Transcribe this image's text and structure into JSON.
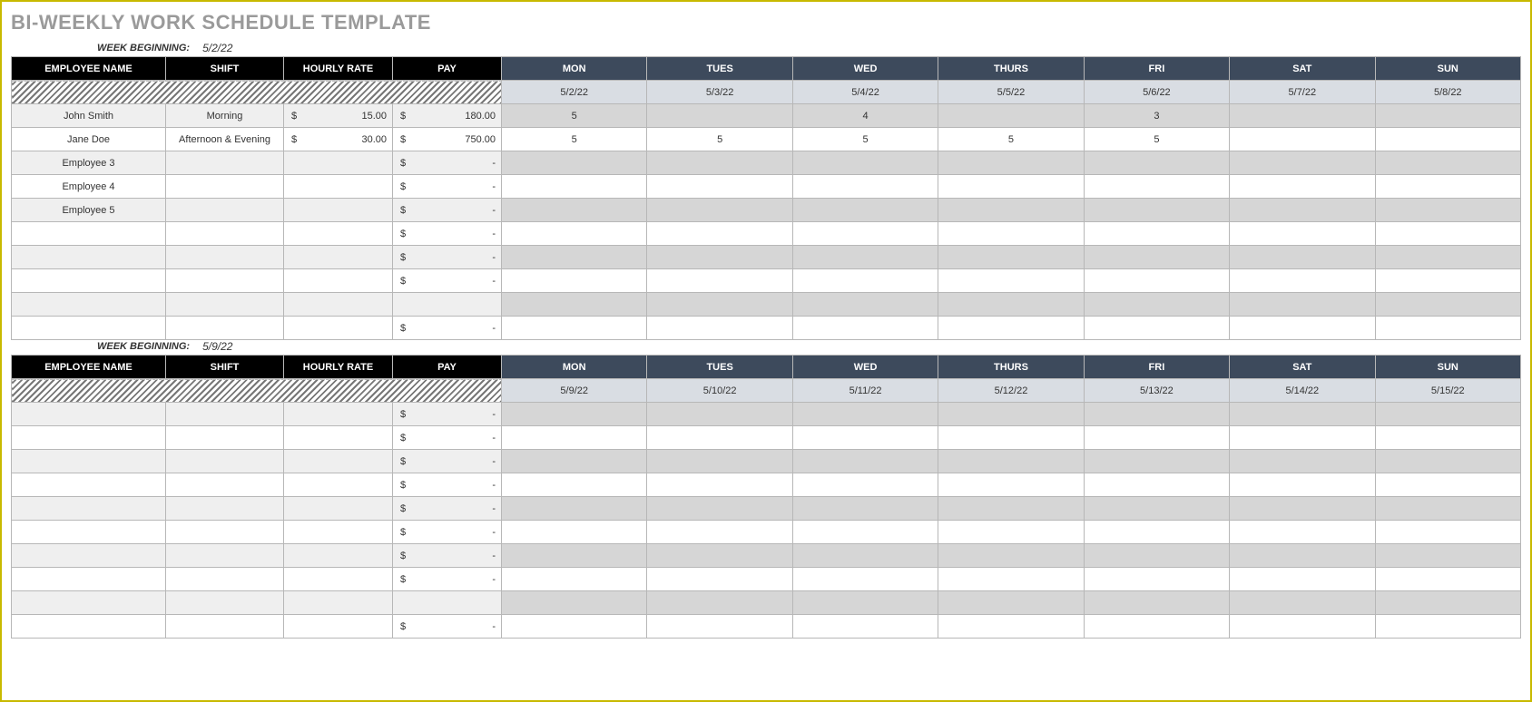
{
  "title": "BI-WEEKLY WORK SCHEDULE TEMPLATE",
  "currency_symbol": "$",
  "headers_left": [
    "EMPLOYEE NAME",
    "SHIFT",
    "HOURLY RATE",
    "PAY"
  ],
  "headers_days": [
    "MON",
    "TUES",
    "WED",
    "THURS",
    "FRI",
    "SAT",
    "SUN"
  ],
  "week_beginning_label": "WEEK BEGINNING:",
  "weeks": [
    {
      "week_beginning": "5/2/22",
      "dates": [
        "5/2/22",
        "5/3/22",
        "5/4/22",
        "5/5/22",
        "5/6/22",
        "5/7/22",
        "5/8/22"
      ],
      "rows": [
        {
          "name": "John Smith",
          "shift": "Morning",
          "rate": "15.00",
          "pay": "180.00",
          "days": [
            "5",
            "",
            "4",
            "",
            "3",
            "",
            ""
          ]
        },
        {
          "name": "Jane Doe",
          "shift": "Afternoon & Evening",
          "rate": "30.00",
          "pay": "750.00",
          "days": [
            "5",
            "5",
            "5",
            "5",
            "5",
            "",
            ""
          ]
        },
        {
          "name": "Employee 3",
          "shift": "",
          "rate": "",
          "pay": "-",
          "days": [
            "",
            "",
            "",
            "",
            "",
            "",
            ""
          ]
        },
        {
          "name": "Employee 4",
          "shift": "",
          "rate": "",
          "pay": "-",
          "days": [
            "",
            "",
            "",
            "",
            "",
            "",
            ""
          ]
        },
        {
          "name": "Employee 5",
          "shift": "",
          "rate": "",
          "pay": "-",
          "days": [
            "",
            "",
            "",
            "",
            "",
            "",
            ""
          ]
        },
        {
          "name": "",
          "shift": "",
          "rate": "",
          "pay": "-",
          "days": [
            "",
            "",
            "",
            "",
            "",
            "",
            ""
          ]
        },
        {
          "name": "",
          "shift": "",
          "rate": "",
          "pay": "-",
          "days": [
            "",
            "",
            "",
            "",
            "",
            "",
            ""
          ]
        },
        {
          "name": "",
          "shift": "",
          "rate": "",
          "pay": "-",
          "days": [
            "",
            "",
            "",
            "",
            "",
            "",
            ""
          ]
        },
        {
          "name": "",
          "shift": "",
          "rate": "",
          "pay": "",
          "days": [
            "",
            "",
            "",
            "",
            "",
            "",
            ""
          ]
        },
        {
          "name": "",
          "shift": "",
          "rate": "",
          "pay": "-",
          "days": [
            "",
            "",
            "",
            "",
            "",
            "",
            ""
          ]
        }
      ]
    },
    {
      "week_beginning": "5/9/22",
      "dates": [
        "5/9/22",
        "5/10/22",
        "5/11/22",
        "5/12/22",
        "5/13/22",
        "5/14/22",
        "5/15/22"
      ],
      "rows": [
        {
          "name": "",
          "shift": "",
          "rate": "",
          "pay": "-",
          "days": [
            "",
            "",
            "",
            "",
            "",
            "",
            ""
          ]
        },
        {
          "name": "",
          "shift": "",
          "rate": "",
          "pay": "-",
          "days": [
            "",
            "",
            "",
            "",
            "",
            "",
            ""
          ]
        },
        {
          "name": "",
          "shift": "",
          "rate": "",
          "pay": "-",
          "days": [
            "",
            "",
            "",
            "",
            "",
            "",
            ""
          ]
        },
        {
          "name": "",
          "shift": "",
          "rate": "",
          "pay": "-",
          "days": [
            "",
            "",
            "",
            "",
            "",
            "",
            ""
          ]
        },
        {
          "name": "",
          "shift": "",
          "rate": "",
          "pay": "-",
          "days": [
            "",
            "",
            "",
            "",
            "",
            "",
            ""
          ]
        },
        {
          "name": "",
          "shift": "",
          "rate": "",
          "pay": "-",
          "days": [
            "",
            "",
            "",
            "",
            "",
            "",
            ""
          ]
        },
        {
          "name": "",
          "shift": "",
          "rate": "",
          "pay": "-",
          "days": [
            "",
            "",
            "",
            "",
            "",
            "",
            ""
          ]
        },
        {
          "name": "",
          "shift": "",
          "rate": "",
          "pay": "-",
          "days": [
            "",
            "",
            "",
            "",
            "",
            "",
            ""
          ]
        },
        {
          "name": "",
          "shift": "",
          "rate": "",
          "pay": "",
          "days": [
            "",
            "",
            "",
            "",
            "",
            "",
            ""
          ]
        },
        {
          "name": "",
          "shift": "",
          "rate": "",
          "pay": "-",
          "days": [
            "",
            "",
            "",
            "",
            "",
            "",
            ""
          ]
        }
      ]
    }
  ]
}
